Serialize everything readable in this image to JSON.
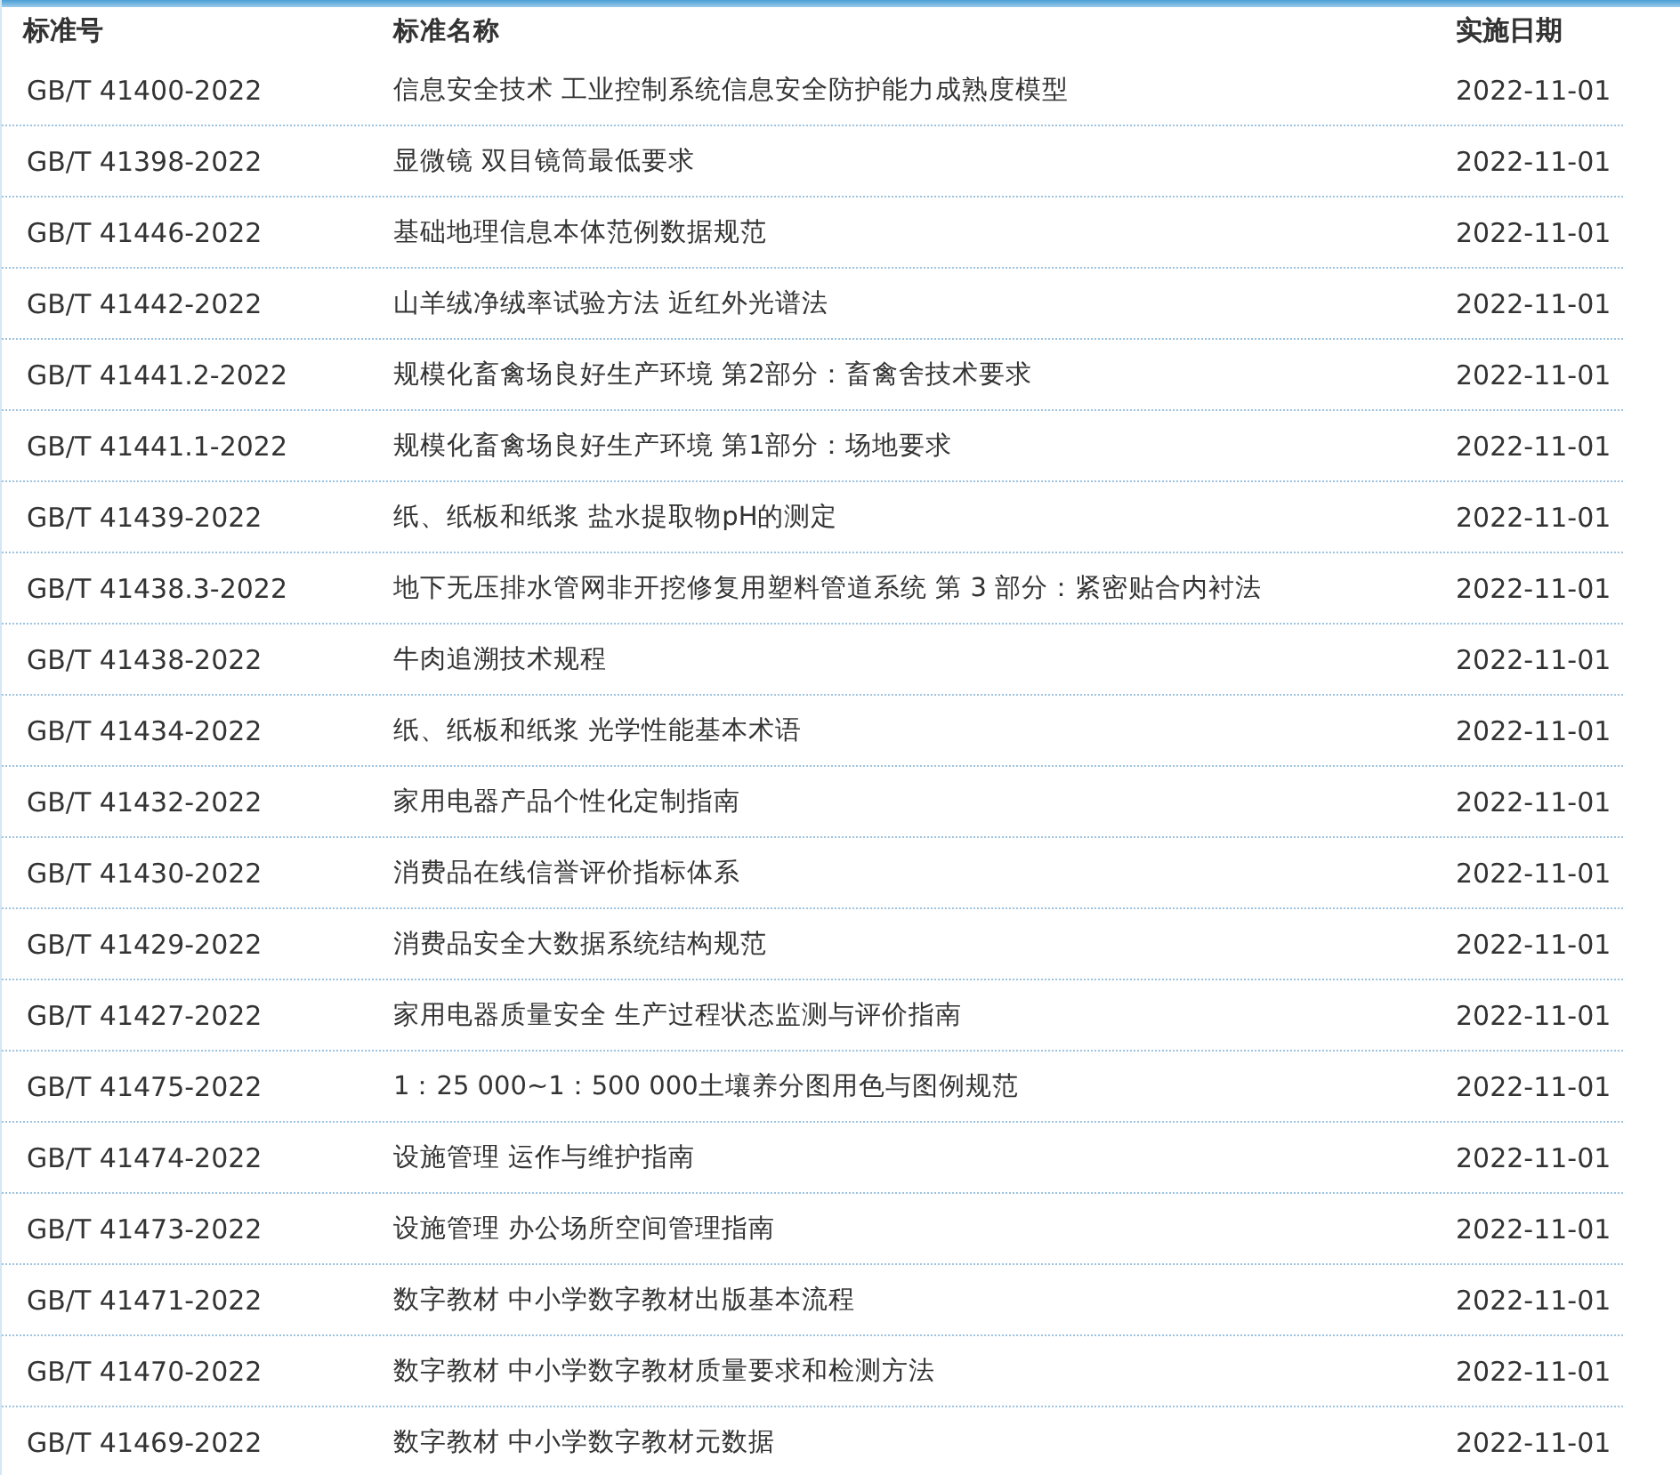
{
  "table": {
    "columns": [
      "标准号",
      "标准名称",
      "实施日期"
    ],
    "rows": [
      {
        "code": "GB/T 41400-2022",
        "name": "信息安全技术 工业控制系统信息安全防护能力成熟度模型",
        "date": "2022-11-01"
      },
      {
        "code": "GB/T 41398-2022",
        "name": "显微镜 双目镜筒最低要求",
        "date": "2022-11-01"
      },
      {
        "code": "GB/T 41446-2022",
        "name": "基础地理信息本体范例数据规范",
        "date": "2022-11-01"
      },
      {
        "code": "GB/T 41442-2022",
        "name": "山羊绒净绒率试验方法 近红外光谱法",
        "date": "2022-11-01"
      },
      {
        "code": "GB/T 41441.2-2022",
        "name": "规模化畜禽场良好生产环境 第2部分：畜禽舍技术要求",
        "date": "2022-11-01"
      },
      {
        "code": "GB/T 41441.1-2022",
        "name": "规模化畜禽场良好生产环境 第1部分：场地要求",
        "date": "2022-11-01"
      },
      {
        "code": "GB/T 41439-2022",
        "name": "纸、纸板和纸浆 盐水提取物pH的测定",
        "date": "2022-11-01"
      },
      {
        "code": "GB/T 41438.3-2022",
        "name": "地下无压排水管网非开挖修复用塑料管道系统 第 3 部分：紧密贴合内衬法",
        "date": "2022-11-01"
      },
      {
        "code": "GB/T 41438-2022",
        "name": "牛肉追溯技术规程",
        "date": "2022-11-01"
      },
      {
        "code": "GB/T 41434-2022",
        "name": "纸、纸板和纸浆 光学性能基本术语",
        "date": "2022-11-01"
      },
      {
        "code": "GB/T 41432-2022",
        "name": "家用电器产品个性化定制指南",
        "date": "2022-11-01"
      },
      {
        "code": "GB/T 41430-2022",
        "name": "消费品在线信誉评价指标体系",
        "date": "2022-11-01"
      },
      {
        "code": "GB/T 41429-2022",
        "name": "消费品安全大数据系统结构规范",
        "date": "2022-11-01"
      },
      {
        "code": "GB/T 41427-2022",
        "name": "家用电器质量安全 生产过程状态监测与评价指南",
        "date": "2022-11-01"
      },
      {
        "code": "GB/T 41475-2022",
        "name": "1：25 000~1：500 000土壤养分图用色与图例规范",
        "date": "2022-11-01"
      },
      {
        "code": "GB/T 41474-2022",
        "name": "设施管理 运作与维护指南",
        "date": "2022-11-01"
      },
      {
        "code": "GB/T 41473-2022",
        "name": "设施管理 办公场所空间管理指南",
        "date": "2022-11-01"
      },
      {
        "code": "GB/T 41471-2022",
        "name": "数字教材 中小学数字教材出版基本流程",
        "date": "2022-11-01"
      },
      {
        "code": "GB/T 41470-2022",
        "name": "数字教材 中小学数字教材质量要求和检测方法",
        "date": "2022-11-01"
      },
      {
        "code": "GB/T 41469-2022",
        "name": "数字教材 中小学数字教材元数据",
        "date": "2022-11-01"
      }
    ]
  }
}
